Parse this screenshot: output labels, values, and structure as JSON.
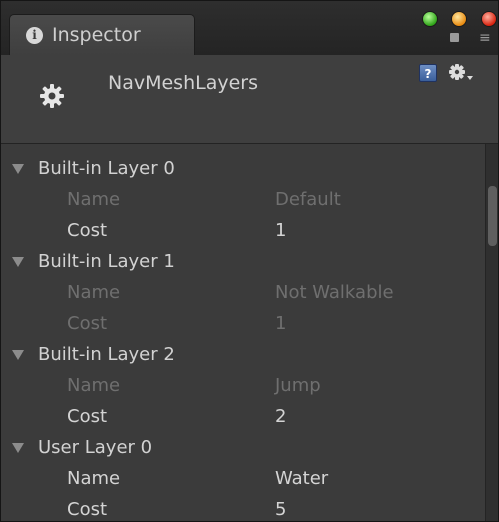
{
  "window": {
    "tab_title": "Inspector",
    "tab_icon": "info-icon",
    "window_buttons": [
      "green-dot",
      "yellow-dot",
      "red-dot"
    ],
    "pane_options_icon": "pane-options-icon",
    "pane_options_glyph": "≡"
  },
  "header": {
    "asset_name": "NavMeshLayers",
    "asset_icon": "gear-icon",
    "help_icon": "help-icon",
    "help_glyph": "?",
    "settings_icon": "settings-gear-icon"
  },
  "layers": [
    {
      "label": "Built-in Layer 0",
      "expanded": true,
      "name_label": "Name",
      "name_value": "Default",
      "name_editable": false,
      "cost_label": "Cost",
      "cost_value": "1",
      "cost_editable": true
    },
    {
      "label": "Built-in Layer 1",
      "expanded": true,
      "name_label": "Name",
      "name_value": "Not Walkable",
      "name_editable": false,
      "cost_label": "Cost",
      "cost_value": "1",
      "cost_editable": false
    },
    {
      "label": "Built-in Layer 2",
      "expanded": true,
      "name_label": "Name",
      "name_value": "Jump",
      "name_editable": false,
      "cost_label": "Cost",
      "cost_value": "2",
      "cost_editable": true
    },
    {
      "label": "User Layer 0",
      "expanded": true,
      "name_label": "Name",
      "name_value": "Water",
      "name_editable": true,
      "cost_label": "Cost",
      "cost_value": "5",
      "cost_editable": true
    }
  ],
  "colors": {
    "panel_background": "#3b3b3b",
    "header_background": "#3f3f3f",
    "text_enabled": "#d4d4d4",
    "text_disabled": "#6f6f6f",
    "help_icon_blue": "#4a6fae"
  }
}
